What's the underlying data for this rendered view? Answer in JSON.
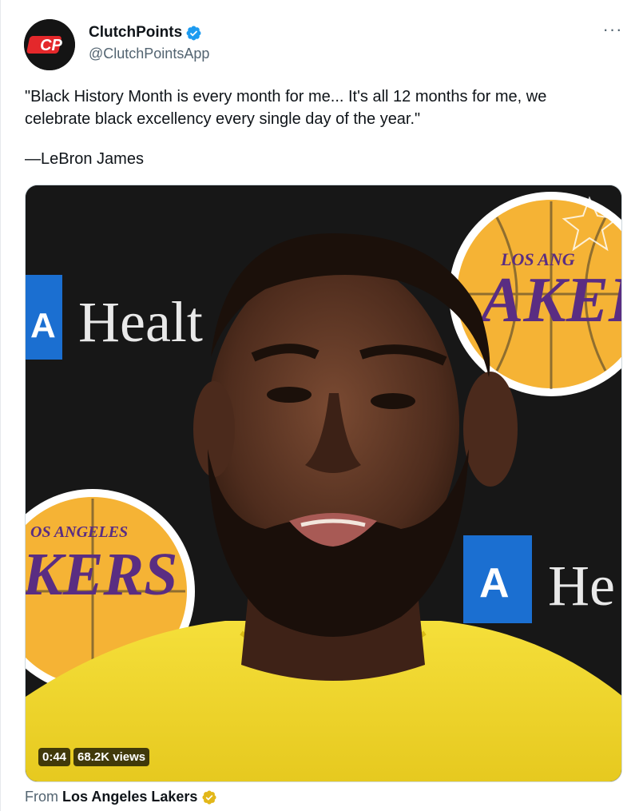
{
  "author": {
    "display_name": "ClutchPoints",
    "handle": "@ClutchPointsApp",
    "avatar_text": "CP",
    "verified_color": "#1d9bf0"
  },
  "more_menu": {
    "label": "···"
  },
  "tweet": {
    "text": "\"Black History Month is every month for me... It's all 12 months for me, we celebrate black excellency every single day of the year.\"",
    "attribution": "—LeBron James"
  },
  "media": {
    "type": "video",
    "duration": "0:44",
    "views": "68.2K views",
    "backdrop_text_1": "Healt",
    "backdrop_text_2": "He",
    "logo_text_top": "LOS ANG",
    "logo_text_main": "AKEI",
    "logo_text_left_top": "OS ANGELES",
    "logo_text_left_main": "KERS",
    "sponsor_letter": "A",
    "colors": {
      "lakers_gold": "#f5b335",
      "lakers_purple": "#5a2d82",
      "shirt": "#f3d92b",
      "sponsor_blue": "#1b6fd1"
    }
  },
  "source": {
    "prefix": "From",
    "account": "Los Angeles Lakers",
    "badge_color": "#e2b719"
  }
}
